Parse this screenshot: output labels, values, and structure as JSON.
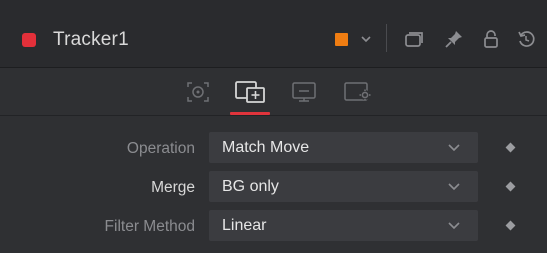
{
  "header": {
    "title": "Tracker1",
    "dot_color": "#e3303a",
    "swatch_color": "#ef7d12",
    "icons": [
      "version-chevron-icon",
      "window-icon",
      "pin-icon",
      "lock-icon",
      "reset-icon"
    ]
  },
  "tabs": [
    {
      "name": "tracker-tab",
      "icon": "tracker-target-icon",
      "active": false
    },
    {
      "name": "operation-tab",
      "icon": "operation-icon",
      "active": true
    },
    {
      "name": "display-tab",
      "icon": "display-icon",
      "active": false
    },
    {
      "name": "settings-tab",
      "icon": "settings-icon",
      "active": false
    }
  ],
  "rows": [
    {
      "label": "Operation",
      "value": "Match Move"
    },
    {
      "label": "Merge",
      "value": "BG only"
    },
    {
      "label": "Filter Method",
      "value": "Linear"
    }
  ]
}
